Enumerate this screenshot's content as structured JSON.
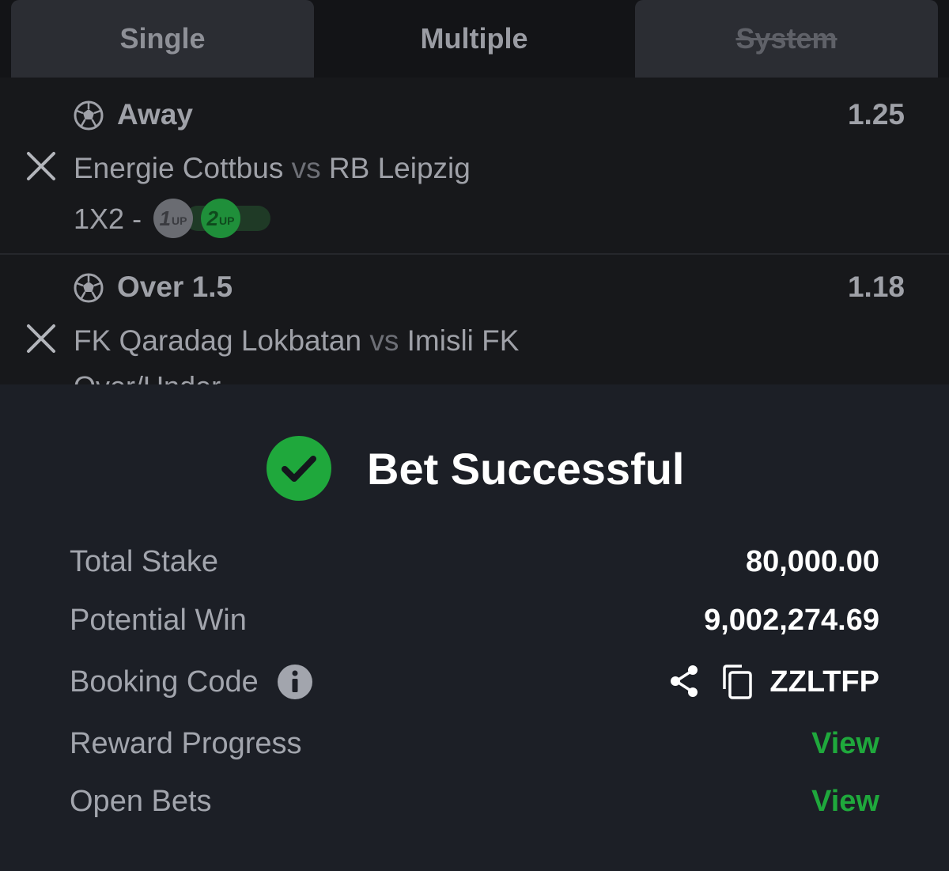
{
  "tabs": {
    "single": "Single",
    "multiple": "Multiple",
    "system": "System"
  },
  "bets": [
    {
      "pick": "Away",
      "odds": "1.25",
      "home": "Energie Cottbus",
      "vs": "vs",
      "away": "RB Leipzig",
      "market": "1X2",
      "market_separator": "-",
      "badges": [
        {
          "number": "1",
          "suffix": "UP"
        },
        {
          "number": "2",
          "suffix": "UP"
        }
      ]
    },
    {
      "pick": "Over 1.5",
      "odds": "1.18",
      "home": "FK Qaradag Lokbatan",
      "vs": "vs",
      "away": "Imisli FK",
      "market": "Over/Under"
    }
  ],
  "success": {
    "title": "Bet Successful",
    "total_stake_label": "Total Stake",
    "total_stake": "80,000.00",
    "potential_win_label": "Potential Win",
    "potential_win": "9,002,274.69",
    "booking_code_label": "Booking Code",
    "booking_code": "ZZLTFP",
    "reward_progress_label": "Reward Progress",
    "reward_progress_link": "View",
    "open_bets_label": "Open Bets",
    "open_bets_link": "View"
  },
  "icons": {
    "sport": "soccer-ball-icon",
    "remove": "close-icon",
    "success": "check-circle-icon",
    "info": "info-icon",
    "share": "share-icon",
    "copy": "copy-icon"
  },
  "colors": {
    "accent_green": "#1fa83c",
    "panel_bg": "#1c1f26",
    "list_bg": "#17181b"
  }
}
